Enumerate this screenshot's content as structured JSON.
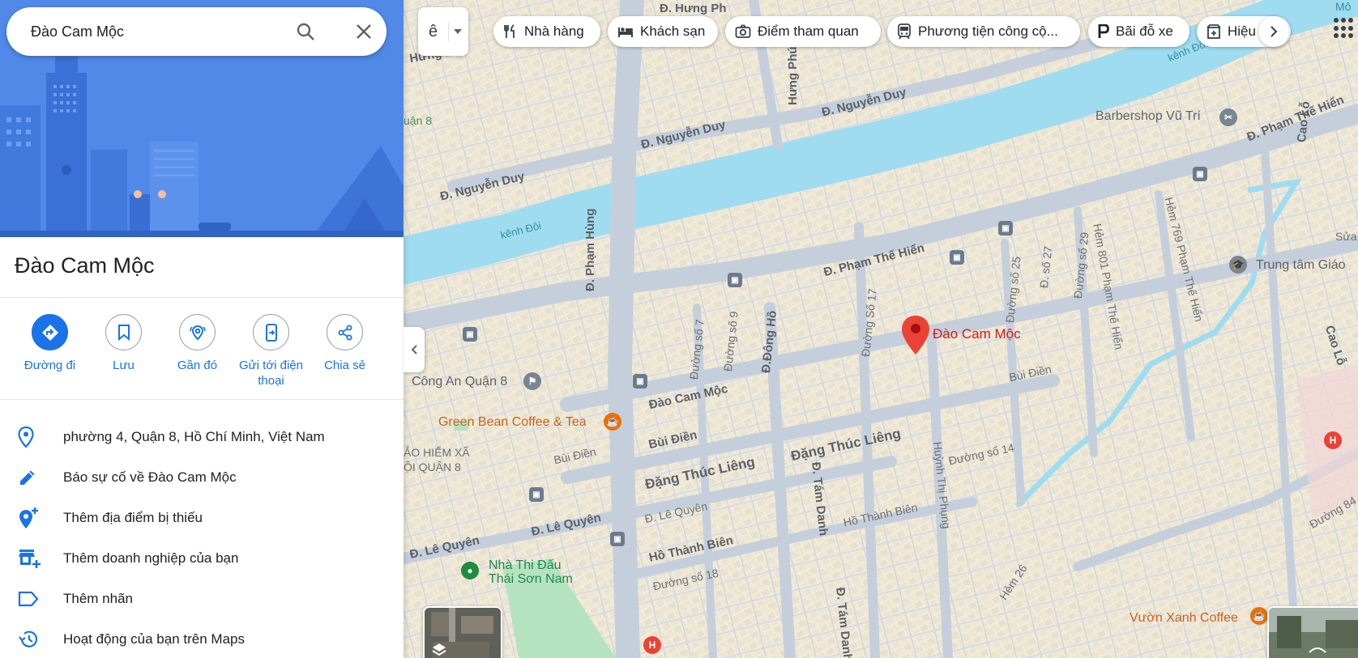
{
  "search": {
    "value": "Đào Cam Mộc",
    "search_icon": "search-icon",
    "clear_icon": "close-icon"
  },
  "place": {
    "title": "Đào Cam Mộc"
  },
  "actions": [
    {
      "label": "Đường đi",
      "icon": "directions-icon"
    },
    {
      "label": "Lưu",
      "icon": "bookmark-icon"
    },
    {
      "label": "Gần đó",
      "icon": "nearby-icon"
    },
    {
      "label": "Gửi tới điện thoại",
      "icon": "send-to-phone-icon"
    },
    {
      "label": "Chia sẻ",
      "icon": "share-icon"
    }
  ],
  "info": [
    {
      "text": "phường 4, Quận 8, Hồ Chí Minh, Việt Nam",
      "icon": "location-pin-icon"
    },
    {
      "text": "Báo sự cố về Đào Cam Mộc",
      "icon": "pencil-icon"
    },
    {
      "text": "Thêm địa điểm bị thiếu",
      "icon": "add-place-icon"
    },
    {
      "text": "Thêm doanh nghiệp của bạn",
      "icon": "add-business-icon"
    },
    {
      "text": "Thêm nhãn",
      "icon": "label-icon"
    },
    {
      "text": "Hoạt động của bạn trên Maps",
      "icon": "history-icon"
    }
  ],
  "toolbar": {
    "lang_glyph": "ê",
    "chips": [
      {
        "label": "Nhà hàng",
        "icon": "restaurant-icon"
      },
      {
        "label": "Khách sạn",
        "icon": "hotel-icon"
      },
      {
        "label": "Điểm tham quan",
        "icon": "camera-icon"
      },
      {
        "label": "Phương tiện công cộ...",
        "icon": "transit-icon"
      },
      {
        "label": "Bãi đỗ xe",
        "icon": "parking-icon"
      },
      {
        "label": "Hiệu",
        "icon": "pharmacy-icon"
      }
    ]
  },
  "map": {
    "pin_label": "Đào Cam Mộc",
    "streets": {
      "nguyen_duy_1": "Đ. Nguyễn Duy",
      "nguyen_duy_2": "Đ. Nguyễn Duy",
      "nguyen_duy_3": "Đ. Nguyễn Duy",
      "pham_the_hien_1": "Đ. Phạm Thế Hiển",
      "pham_the_hien_2": "Đ. Phạm Thế Hiển",
      "pham_hung": "Đ. Phạm Hùng",
      "hung_phu": "Hưng Phú",
      "hung_phu_top": "Đ. Hưng Ph",
      "hung_phu_left": "Hưng Phú",
      "dao_cam_moc": "Đào Cam Mộc",
      "bui_dien_1": "Bùi Điền",
      "bui_dien_2": "Bùi Điền",
      "bui_dien_3": "Bùi Điền",
      "dang_thuc_lieng_1": "Đặng Thúc Liêng",
      "dang_thuc_lieng_2": "Đặng Thúc Liêng",
      "le_quyen_1": "Đ. Lê Quyên",
      "le_quyen_2": "Đ. Lê Quyên",
      "le_quyen_3": "Đ. Lê Quyên",
      "ho_thanh_bien_1": "Hồ Thành Biên",
      "ho_thanh_bien_2": "Hồ Thành Biên",
      "duong_so_18": "Đường số 18",
      "duong_so_14": "Đường số 14",
      "duong_so_17": "Đường Số 17",
      "duong_so_7": "Đường số 7",
      "duong_so_9": "Đường số 9",
      "dong_ho": "Đ.Đông Hồ",
      "duong_so_25": "Đường số 25",
      "d_so_27": "Đ. số 27",
      "duong_so_29": "Đường số 29",
      "hem_801": "Hẻm 801 Phạm Thế Hiển",
      "hem_769": "Hẻm 769 Phạm Thế Hiển",
      "tam_danh_1": "Đ. Tám Danh",
      "tam_danh_2": "Đ. Tám Danh",
      "huynh_thi_phung": "Huỳnh Thị Phụng",
      "hem_26": "Hẻm 26",
      "cao_lo_1": "Cao Lỗ",
      "cao_lo_2": "Cao Lỗ",
      "duong_84": "Đường 84",
      "kenh_doi": "kênh Đôi",
      "kenh_doi_2": "kênh Đôi",
      "quan_8": "uận 8",
      "bao_hiem": "ẢO HIỂM XÃ\nỘI QUẬN 8",
      "sua": "Sửa",
      "mo": "Mô"
    },
    "pois": {
      "barbershop": "Barbershop Vũ Trí",
      "trung_tam": "Trung tâm Giáo",
      "cong_an": "Công An Quận 8",
      "green_bean": "Green Bean Coffee & Tea",
      "nha_thi_dau": "Nhà Thi Đấu\nThái Sơn Nam",
      "vuon_xanh": "Vườn Xanh Coffee"
    }
  },
  "colors": {
    "accent": "#1a73e8",
    "water": "#9fdcf0",
    "road": "#c8d1de",
    "block": "#f4efe2",
    "pin": "#ea4335"
  }
}
